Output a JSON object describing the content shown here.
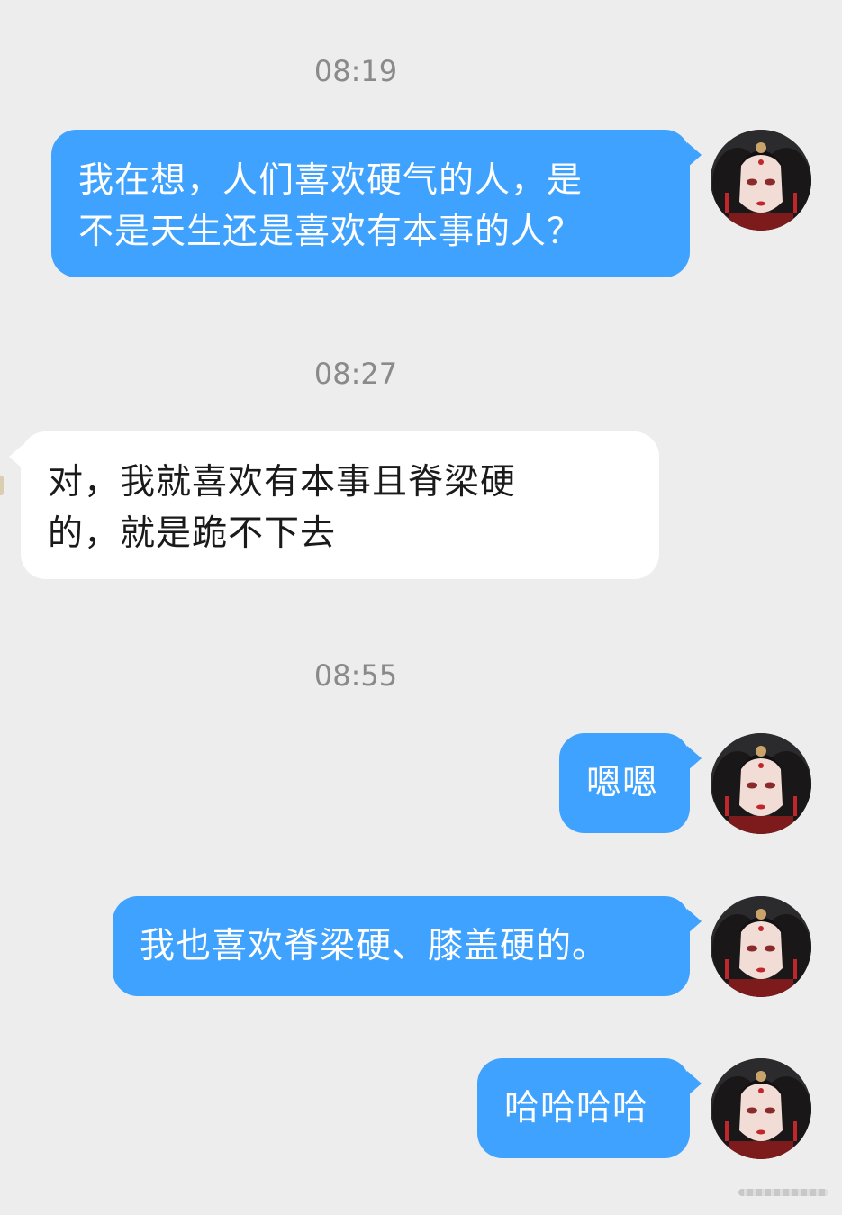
{
  "messages": [
    {
      "timestamp": "08:19",
      "direction": "out",
      "lines": [
        "我在想，人们喜欢硬气的人，是",
        "不是天生还是喜欢有本事的人？"
      ]
    },
    {
      "timestamp": "08:27",
      "direction": "in",
      "lines": [
        "对，我就喜欢有本事且脊梁硬",
        "的，就是跪不下去"
      ]
    },
    {
      "timestamp": "08:55",
      "direction": "out",
      "lines": [
        "嗯嗯"
      ]
    },
    {
      "direction": "out",
      "lines": [
        "我也喜欢脊梁硬、膝盖硬的。"
      ]
    },
    {
      "direction": "out",
      "lines": [
        "哈哈哈哈"
      ]
    }
  ],
  "colors": {
    "background": "#ededed",
    "outgoing_bubble": "#3fa2ff",
    "incoming_bubble": "#ffffff",
    "timestamp_text": "#8a8a8a"
  },
  "avatar": {
    "icon": "user-avatar-icon"
  }
}
